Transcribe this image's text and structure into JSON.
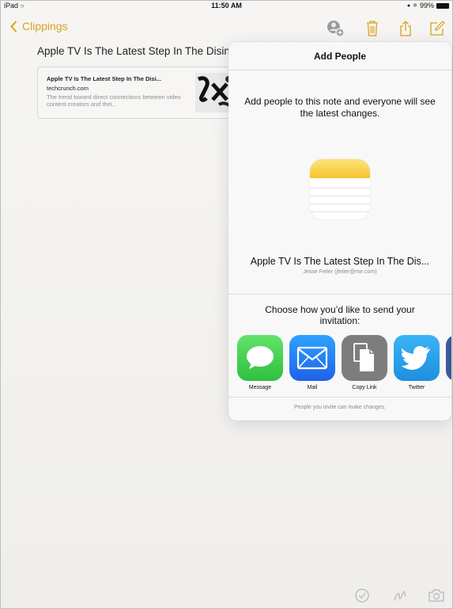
{
  "status_bar": {
    "carrier": "iPad",
    "time": "11:50 AM",
    "battery": "99%"
  },
  "nav": {
    "back_label": "Clippings",
    "icons": [
      "add-people-icon",
      "trash-icon",
      "share-icon",
      "compose-icon"
    ]
  },
  "note": {
    "title": "Apple TV Is The Latest Step In The Disinte",
    "link_card": {
      "title": "Apple TV Is The Latest Step In The Disi...",
      "domain": "techcrunch.com",
      "description": "The trend toward direct connections between video content creators and thei..."
    }
  },
  "popover": {
    "title": "Add People",
    "description": "Add people to this note and everyone will see the latest changes.",
    "note_title": "Apple TV Is The Latest Step In The Dis...",
    "owner": "Jesse Feiler (jfeiler@me.com)",
    "choose_text": "Choose how you’d like to send your invitation:",
    "share_options": [
      {
        "label": "Message",
        "icon": "message-icon",
        "color": "#3fcd4d"
      },
      {
        "label": "Mail",
        "icon": "mail-icon",
        "color": "#2f7cf6"
      },
      {
        "label": "Copy Link",
        "icon": "copy-link-icon",
        "color": "#7a7a7a"
      },
      {
        "label": "Twitter",
        "icon": "twitter-icon",
        "color": "#1da1f2"
      }
    ],
    "footer": "People you invite can make changes."
  },
  "toolbar": {
    "icons": [
      "checklist-icon",
      "sketch-icon",
      "camera-icon"
    ]
  },
  "colors": {
    "accent": "#d9a21c",
    "background": "#f2f1ef",
    "popover": "#f8f8f8"
  }
}
